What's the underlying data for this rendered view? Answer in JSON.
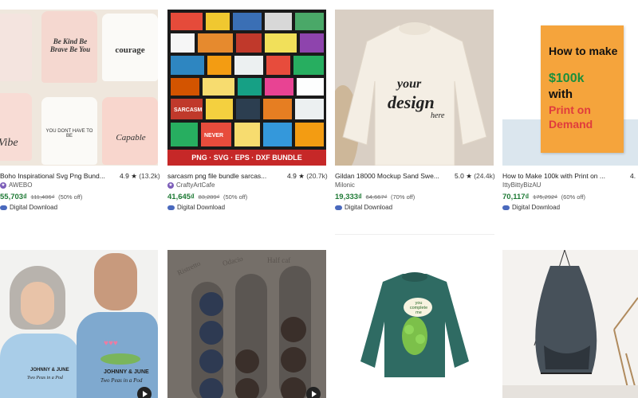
{
  "listings": [
    {
      "title": "Boho Inspirational Svg Png Bund...",
      "rating": "4.9",
      "count": "(13.2k)",
      "shop": "AWEBO",
      "price": "55,703₫",
      "original": "111,406₫",
      "discount": "(50% off)",
      "download": "Digital Download",
      "image_texts": [
        "Be Kind Be Brave Be You",
        "courage",
        "Vibe",
        "YOU DONT HAVE TO BE",
        "Capable"
      ]
    },
    {
      "title": "sarcasm png file bundle sarcas...",
      "rating": "4.9",
      "count": "(20.7k)",
      "shop": "CraftyArtCafe",
      "price": "41,645₫",
      "original": "83,289₫",
      "discount": "(50% off)",
      "download": "Digital Download",
      "image_texts": [
        "PNG · SVG · EPS · DXF BUNDLE",
        "SARCASM",
        "NEVER",
        "GROW UP",
        "AWESOME",
        "FABULOUS"
      ]
    },
    {
      "title": "Gildan 18000 Mockup Sand Swe...",
      "rating": "5.0",
      "count": "(24.4k)",
      "shop": "Milonic",
      "price": "19,333₫",
      "original": "64,667₫",
      "discount": "(70% off)",
      "download": "Digital Download",
      "image_texts": [
        "your",
        "design",
        "here"
      ]
    },
    {
      "title": "How to Make 100k with Print on ...",
      "rating": "4.",
      "count": "",
      "shop": "IttyBittyBizAU",
      "price": "70,117₫",
      "original": "175,292₫",
      "discount": "(60% off)",
      "download": "Digital Download",
      "image_texts": [
        "How to make",
        "$100k",
        "with",
        "Print on",
        "Demand"
      ]
    }
  ],
  "row2": [
    {
      "image_texts": [
        "JOHNNY & JUNE",
        "Two Peas in a Pod"
      ]
    },
    {
      "image_texts": [
        "Ristretto",
        "Odacio",
        "Half caf"
      ]
    },
    {
      "image_texts": [
        "you",
        "complete",
        "me"
      ]
    },
    {
      "image_texts": []
    }
  ],
  "colors": {
    "price_green": "#1e7a35",
    "orange_cover": "#f5a43c",
    "sweatshirt_teal": "#2f6b63"
  },
  "icons": [
    "star-icon",
    "cloud-download-icon",
    "play-icon",
    "shop-badge-icon"
  ]
}
